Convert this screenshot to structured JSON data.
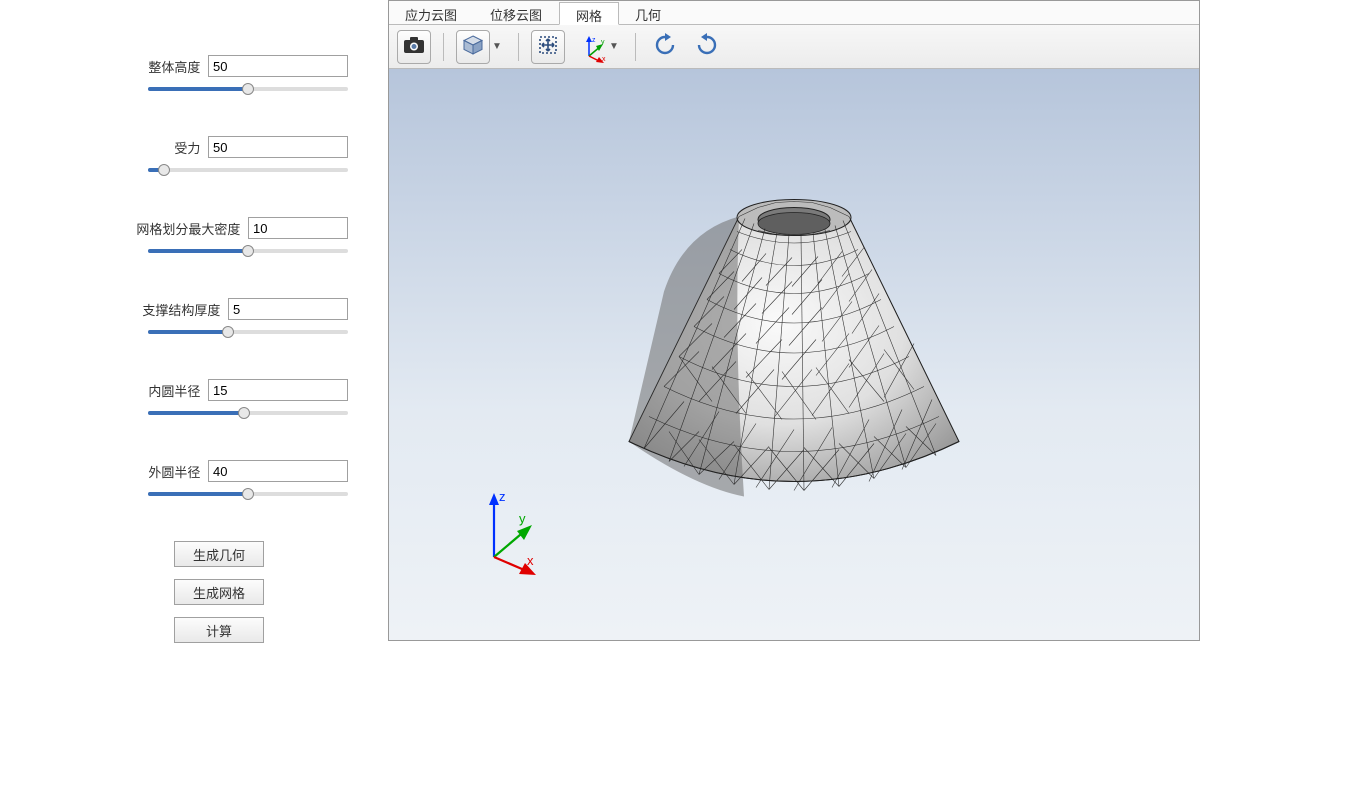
{
  "params": {
    "height": {
      "label": "整体高度",
      "value": "50",
      "slider_pct": 50
    },
    "force": {
      "label": "受力",
      "value": "50",
      "slider_pct": 8
    },
    "mesh_density": {
      "label": "网格划分最大密度",
      "value": "10",
      "slider_pct": 50
    },
    "support_thickness": {
      "label": "支撑结构厚度",
      "value": "5",
      "slider_pct": 40
    },
    "inner_radius": {
      "label": "内圆半径",
      "value": "15",
      "slider_pct": 48
    },
    "outer_radius": {
      "label": "外圆半径",
      "value": "40",
      "slider_pct": 50
    }
  },
  "buttons": {
    "generate_geometry": "生成几何",
    "generate_mesh": "生成网格",
    "compute": "计算"
  },
  "tabs": {
    "stress": "应力云图",
    "displacement": "位移云图",
    "mesh": "网格",
    "geometry": "几何"
  },
  "active_tab": "mesh",
  "axis_labels": {
    "x": "x",
    "y": "y",
    "z": "z"
  }
}
